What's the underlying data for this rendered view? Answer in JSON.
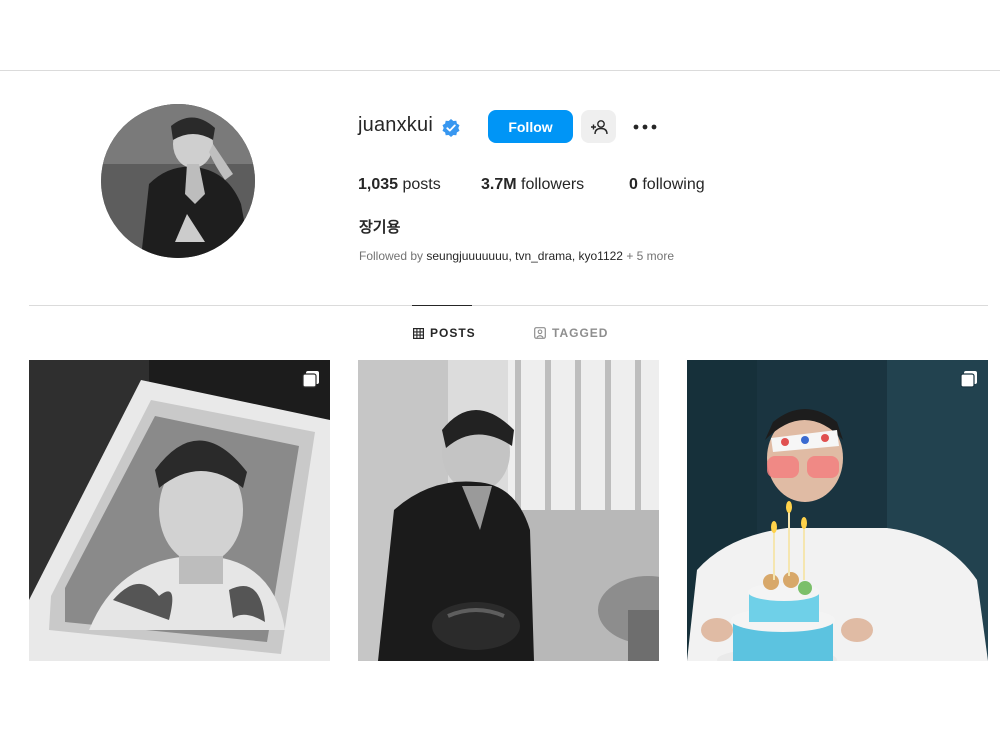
{
  "profile": {
    "username": "juanxkui",
    "verified": true,
    "follow_label": "Follow",
    "full_name": "장기용",
    "stats": {
      "posts_count": "1,035",
      "posts_label": "posts",
      "followers_count": "3.7M",
      "followers_label": "followers",
      "following_count": "0",
      "following_label": "following"
    },
    "followed_by": {
      "prefix": "Followed by",
      "names": "seungjuuuuuuu, tvn_drama, kyo1122",
      "more": "+ 5 more"
    }
  },
  "tabs": [
    {
      "label": "POSTS",
      "icon": "grid-icon",
      "active": true
    },
    {
      "label": "TAGGED",
      "icon": "tagged-icon",
      "active": false
    }
  ],
  "posts": [
    {
      "icon": "carousel-icon",
      "description": "black-and-white printed portrait"
    },
    {
      "icon": "none",
      "description": "black-and-white photo by window"
    },
    {
      "icon": "carousel-icon",
      "description": "birthday cake photo"
    }
  ],
  "colors": {
    "accent": "#0095f6",
    "verified": "#3897f0",
    "text": "#262626",
    "muted": "#737373",
    "divider": "#dbdbdb"
  }
}
